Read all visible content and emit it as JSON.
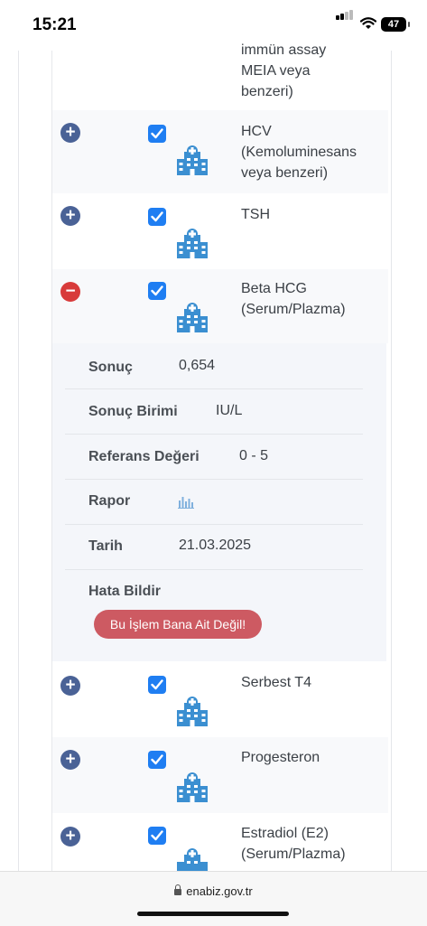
{
  "status_bar": {
    "time": "15:21",
    "battery": "47"
  },
  "tests": [
    {
      "name_lines": [
        "immün assay",
        "MEIA veya",
        "benzeri)"
      ],
      "expanded": false
    },
    {
      "name_lines": [
        "HCV",
        "(Kemoluminesans",
        "veya benzeri)"
      ],
      "expanded": false
    },
    {
      "name_lines": [
        "TSH"
      ],
      "expanded": false
    },
    {
      "name_lines": [
        "Beta HCG",
        "(Serum/Plazma)"
      ],
      "expanded": true
    },
    {
      "name_lines": [
        "Serbest T4"
      ],
      "expanded": false
    },
    {
      "name_lines": [
        "Progesteron"
      ],
      "expanded": false
    },
    {
      "name_lines": [
        "Estradiol (E2)",
        "(Serum/Plazma)"
      ],
      "expanded": false
    }
  ],
  "detail": {
    "result_label": "Sonuç",
    "result_value": "0,654",
    "unit_label": "Sonuç Birimi",
    "unit_value": "IU/L",
    "reference_label": "Referans Değeri",
    "reference_value": "0 - 5",
    "report_label": "Rapor",
    "report_icon": "bar-chart-icon",
    "date_label": "Tarih",
    "date_value": "21.03.2025",
    "error_label": "Hata Bildir",
    "error_button": "Bu İşlem Bana Ait Değil!"
  },
  "browser": {
    "url": "enabiz.gov.tr"
  },
  "colors": {
    "plus": "#4a6296",
    "minus": "#d83b3b",
    "checkbox": "#1f7ef2",
    "hospital_icon": "#3b8fd1",
    "error_button": "#cd5a62"
  }
}
